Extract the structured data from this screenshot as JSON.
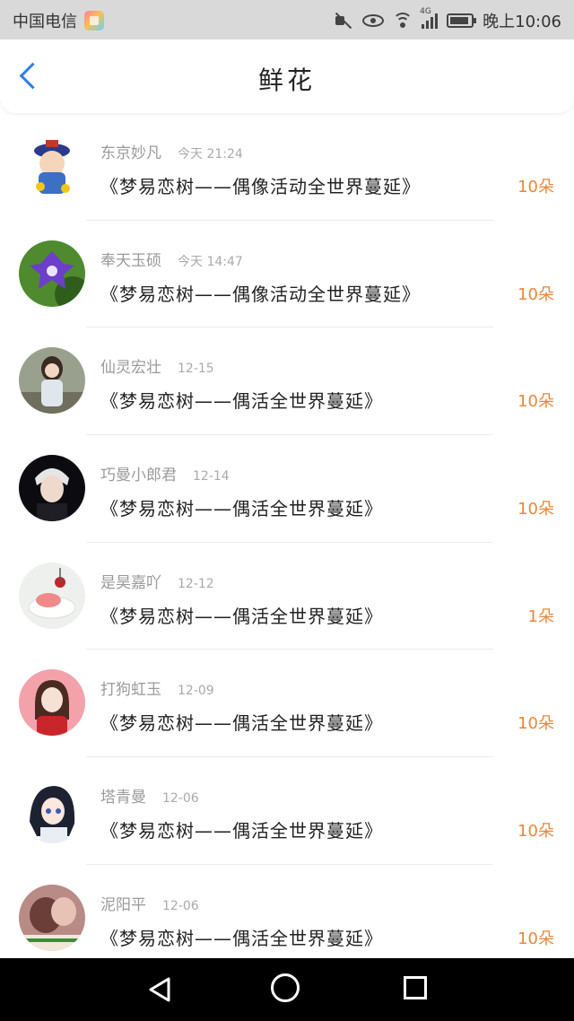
{
  "status_bar": {
    "carrier": "中国电信",
    "network": "4G",
    "time": "晚上10:06"
  },
  "header": {
    "title": "鲜花"
  },
  "gifts": [
    {
      "name": "东京妙凡",
      "time": "今天 21:24",
      "text": "《梦易恋树——偶像活动全世界蔓延》",
      "amount": "10朵"
    },
    {
      "name": "奉天玉硕",
      "time": "今天 14:47",
      "text": "《梦易恋树——偶像活动全世界蔓延》",
      "amount": "10朵"
    },
    {
      "name": "仙灵宏壮",
      "time": "12-15",
      "text": "《梦易恋树——偶活全世界蔓延》",
      "amount": "10朵"
    },
    {
      "name": "巧曼小郎君",
      "time": "12-14",
      "text": "《梦易恋树——偶活全世界蔓延》",
      "amount": "10朵"
    },
    {
      "name": "是昊嘉吖",
      "time": "12-12",
      "text": "《梦易恋树——偶活全世界蔓延》",
      "amount": "1朵"
    },
    {
      "name": "打狗虹玉",
      "time": "12-09",
      "text": "《梦易恋树——偶活全世界蔓延》",
      "amount": "10朵"
    },
    {
      "name": "塔青曼",
      "time": "12-06",
      "text": "《梦易恋树——偶活全世界蔓延》",
      "amount": "10朵"
    },
    {
      "name": "泥阳平",
      "time": "12-06",
      "text": "《梦易恋树——偶活全世界蔓延》",
      "amount": "10朵"
    }
  ],
  "colors": {
    "accent_blue": "#2e7ee8",
    "amount_orange": "#e8873a"
  }
}
